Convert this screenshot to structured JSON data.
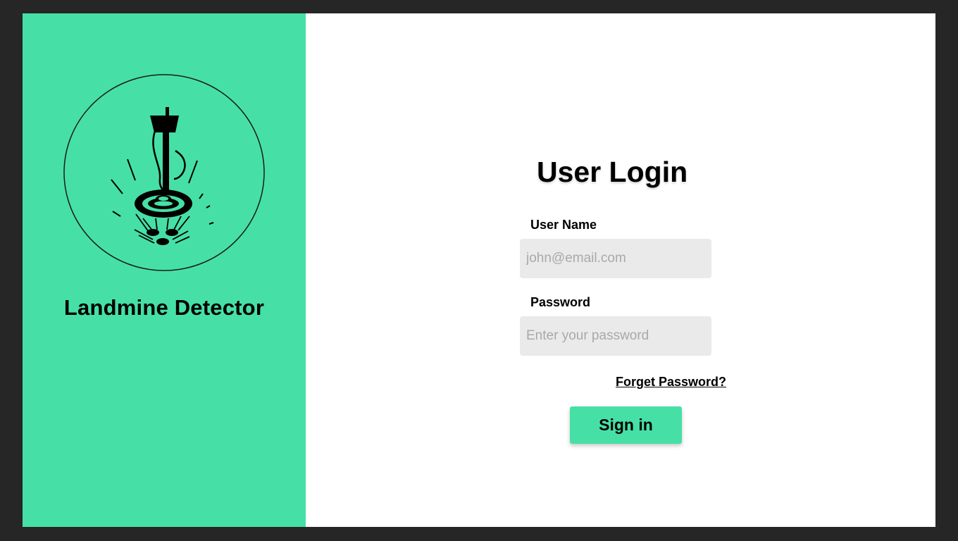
{
  "brand": {
    "name": "Landmine Detector",
    "logo_icon": "metal-detector-icon",
    "accent_color": "#46e0a6"
  },
  "login": {
    "title": "User Login",
    "username_label": "User Name",
    "username_placeholder": "john@email.com",
    "username_value": "",
    "password_label": "Password",
    "password_placeholder": "Enter your password",
    "password_value": "",
    "forgot_label": "Forget Password?",
    "signin_label": "Sign in"
  }
}
